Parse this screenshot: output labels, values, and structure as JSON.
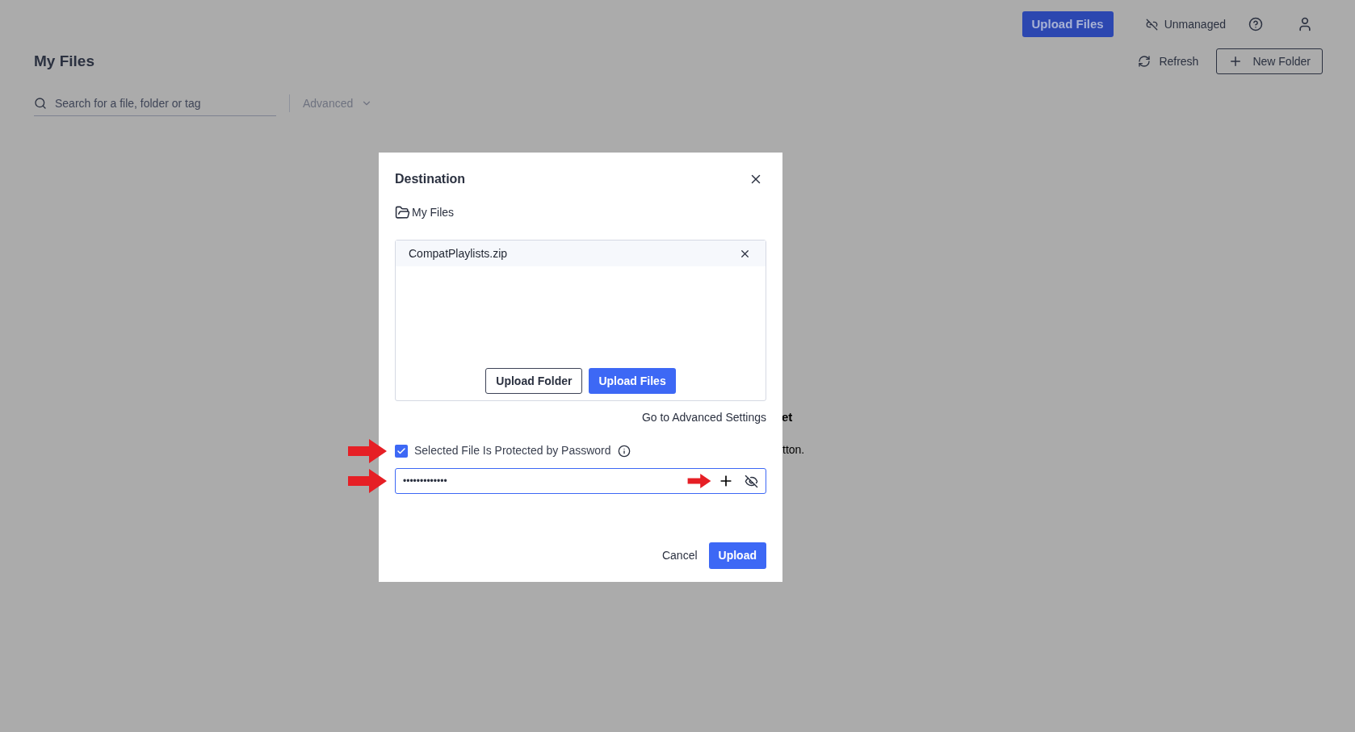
{
  "header": {
    "upload_button": "Upload Files",
    "status": "Unmanaged"
  },
  "page": {
    "title": "My Files",
    "refresh": "Refresh",
    "new_folder": "New Folder",
    "search": {
      "placeholder": "Search for a file, folder or tag"
    },
    "advanced": "Advanced",
    "empty_fragments": [
      "et",
      "tton."
    ]
  },
  "dialog": {
    "title": "Destination",
    "destination": "My Files",
    "files": [
      {
        "name": "CompatPlaylists.zip"
      }
    ],
    "upload_folder": "Upload Folder",
    "upload_files": "Upload Files",
    "advanced_link": "Go to Advanced Settings",
    "password_check": {
      "label": "Selected File Is Protected by Password",
      "checked": true
    },
    "password": {
      "value": "•••••••••••••"
    },
    "buttons": {
      "cancel": "Cancel",
      "upload": "Upload"
    }
  }
}
